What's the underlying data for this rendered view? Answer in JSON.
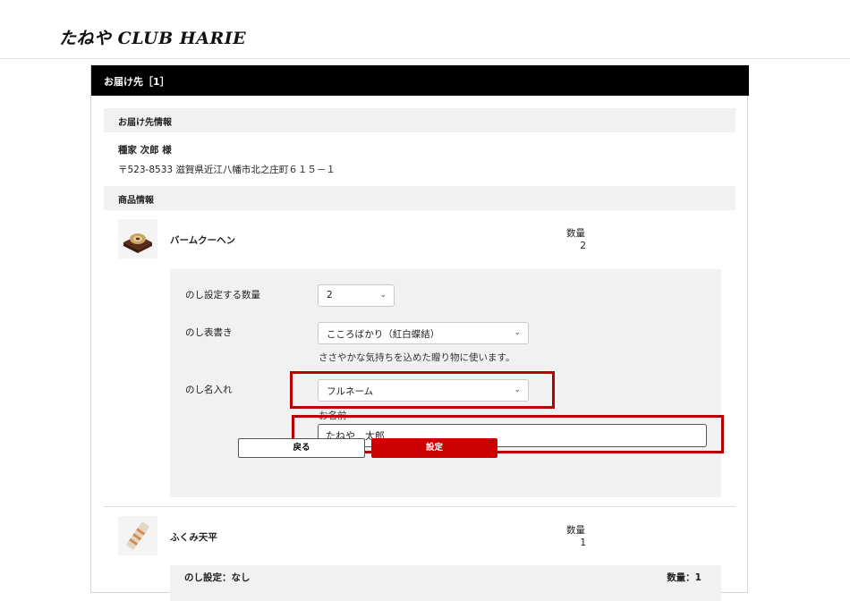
{
  "header": {
    "logo_text": "たねや CLUB HARIE"
  },
  "panel": {
    "title": "お届け先［1］"
  },
  "delivery_info": {
    "section_label": "お届け先情報",
    "name": "種家 次郎 様",
    "address": "〒523-8533 滋賀県近江八幡市北之庄町６１５－１"
  },
  "product_info": {
    "section_label": "商品情報"
  },
  "products": [
    {
      "name": "バームクーヘン",
      "qty_label": "数量",
      "qty": "2",
      "icon": "baumkuchen-image"
    },
    {
      "name": "ふくみ天平",
      "qty_label": "数量",
      "qty": "1",
      "icon": "fukumi-tenpyo-image"
    }
  ],
  "noshi_form": {
    "qty_label": "のし設定する数量",
    "qty_value": "2",
    "title_label": "のし表書き",
    "title_value": "こころばかり（紅白蝶結）",
    "title_hint": "ささやかな気持ちを込めた贈り物に使います。",
    "name_label": "のし名入れ",
    "name_type_value": "フルネーム",
    "name_field_label": "お名前",
    "name_field_value": "たねや　太郎",
    "back_label": "戻る",
    "set_label": "設定"
  },
  "noshi_summary": {
    "label": "のし設定：なし",
    "qty": "数量：1"
  },
  "colors": {
    "accent_red": "#cc0000",
    "highlight_red": "#b80000",
    "header_black": "#000000"
  }
}
